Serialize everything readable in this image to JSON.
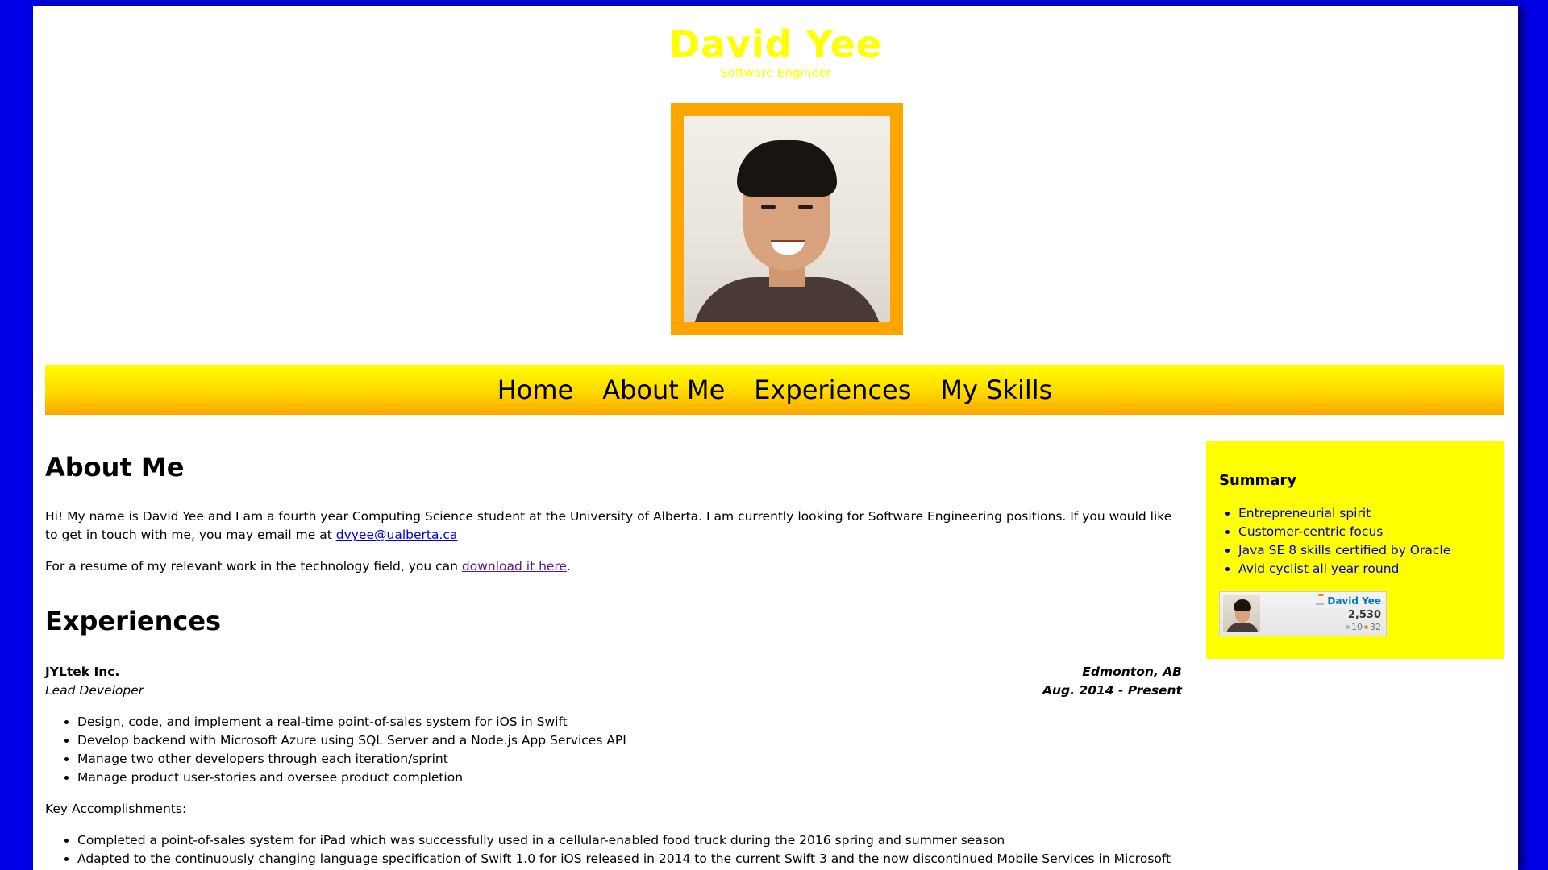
{
  "header": {
    "title": "David Yee",
    "subtitle": "Software Engineer"
  },
  "photo": {
    "alt": "Portrait of David Yee"
  },
  "nav": {
    "items": [
      {
        "label": "Home"
      },
      {
        "label": "About Me"
      },
      {
        "label": "Experiences"
      },
      {
        "label": "My Skills"
      }
    ]
  },
  "about": {
    "title": "About Me",
    "p1_text": "Hi! My name is David Yee and I am a fourth year Computing Science student at the University of Alberta. I am currently looking for Software Engineering positions. If you would like to get in touch with me, you may email me at ",
    "email": "dvyee@ualberta.ca",
    "p2_text": "For a resume of my relevant work in the technology field, you can ",
    "resume_link": "download it here",
    "p2_end": "."
  },
  "experiences": {
    "title": "Experiences",
    "jobs": [
      {
        "company": "JYLtek Inc.",
        "role": "Lead Developer",
        "location": "Edmonton, AB",
        "dates": "Aug. 2014 - Present",
        "duties": [
          "Design, code, and implement a real-time point-of-sales system for iOS in Swift",
          "Develop backend with Microsoft Azure using SQL Server and a Node.js App Services API",
          "Manage two other developers through each iteration/sprint",
          "Manage product user-stories and oversee product completion"
        ],
        "key_label": "Key Accomplishments:",
        "accomplishments": [
          "Completed a point-of-sales system for iPad which was successfully used in a cellular-enabled food truck during the 2016 spring and summer season",
          "Adapted to the continuously changing language specification of Swift 1.0 for iOS released in 2014 to the current Swift 3 and the now discontinued Mobile Services in Microsoft Azure"
        ]
      }
    ]
  },
  "sidebar": {
    "title": "Summary",
    "items": [
      "Entrepreneurial spirit",
      "Customer-centric focus",
      "Java SE 8 skills certified by Oracle",
      "Avid cyclist all year round"
    ],
    "flair": {
      "name": "David Yee",
      "reputation": "2,530",
      "silver": "10",
      "bronze": "32"
    }
  },
  "colors": {
    "background": "#0000e6",
    "title": "#ffff00",
    "photo_frame": "#ffa500",
    "sidebar": "#ffff00",
    "link": "#0000ee",
    "visited_link": "#551a8b"
  }
}
